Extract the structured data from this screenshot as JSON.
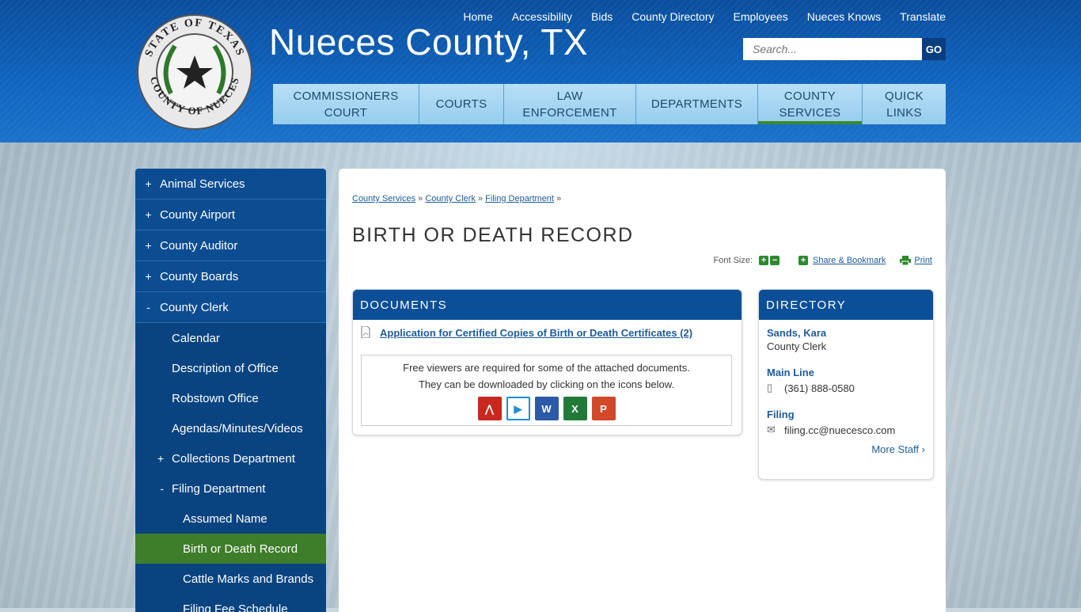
{
  "header": {
    "site_title": "Nueces County, TX",
    "seal_top_text": "STATE OF TEXAS",
    "seal_bottom_text": "COUNTY OF NUECES",
    "utility_links": [
      "Home",
      "Accessibility",
      "Bids",
      "County Directory",
      "Employees",
      "Nueces Knows",
      "Translate"
    ],
    "search": {
      "placeholder": "Search...",
      "button": "GO"
    },
    "main_nav": [
      {
        "line1": "COMMISSIONERS",
        "line2": "COURT"
      },
      {
        "line1": "COURTS",
        "line2": ""
      },
      {
        "line1": "LAW",
        "line2": "ENFORCEMENT"
      },
      {
        "line1": "DEPARTMENTS",
        "line2": ""
      },
      {
        "line1": "COUNTY",
        "line2": "SERVICES"
      },
      {
        "line1": "QUICK",
        "line2": "LINKS"
      }
    ]
  },
  "sidebar": {
    "items": [
      {
        "sym": "+",
        "label": "Animal Services"
      },
      {
        "sym": "+",
        "label": "County Airport"
      },
      {
        "sym": "+",
        "label": "County Auditor"
      },
      {
        "sym": "+",
        "label": "County Boards"
      },
      {
        "sym": "-",
        "label": "County Clerk"
      }
    ],
    "sub_items": [
      {
        "sym": "",
        "label": "Calendar"
      },
      {
        "sym": "",
        "label": "Description of Office"
      },
      {
        "sym": "",
        "label": "Robstown Office"
      },
      {
        "sym": "",
        "label": "Agendas/Minutes/Videos"
      },
      {
        "sym": "+",
        "label": "Collections Department"
      },
      {
        "sym": "-",
        "label": "Filing Department"
      }
    ],
    "sub_sub_items": [
      {
        "label": "Assumed Name"
      },
      {
        "label": "Birth or Death Record"
      },
      {
        "label": "Cattle Marks and Brands"
      },
      {
        "label": "Filing Fee Schedule"
      }
    ]
  },
  "breadcrumb": [
    "County Services",
    "County Clerk",
    "Filing Department"
  ],
  "breadcrumb_sep": "»",
  "page_title": "BIRTH OR DEATH RECORD",
  "tools": {
    "font_size": "Font Size:",
    "share": "Share & Bookmark",
    "print": "Print"
  },
  "documents": {
    "heading": "DOCUMENTS",
    "link": "Application for Certified Copies of Birth or Death Certificates (2)",
    "viewer_line1": "Free viewers are required for some of the attached documents.",
    "viewer_line2": "They can be downloaded by clicking on the icons below.",
    "viewer_icons": [
      {
        "name": "pdf-viewer-icon",
        "color": "#c8281e"
      },
      {
        "name": "media-player-icon",
        "color": "#1a8fd6"
      },
      {
        "name": "word-viewer-icon",
        "color": "#2a5aa8"
      },
      {
        "name": "excel-viewer-icon",
        "color": "#227a3a"
      },
      {
        "name": "powerpoint-viewer-icon",
        "color": "#d2492a"
      }
    ]
  },
  "directory": {
    "heading": "DIRECTORY",
    "name": "Sands, Kara",
    "title": "County Clerk",
    "main_label": "Main Line",
    "phone": "(361) 888-0580",
    "filing_label": "Filing",
    "email": "filing.cc@nuecesco.com",
    "more": "More Staff ›"
  },
  "colors": {
    "brand_blue": "#0b4f98",
    "active_green": "#3e7d2a",
    "nav_light": "#b8dff5"
  }
}
